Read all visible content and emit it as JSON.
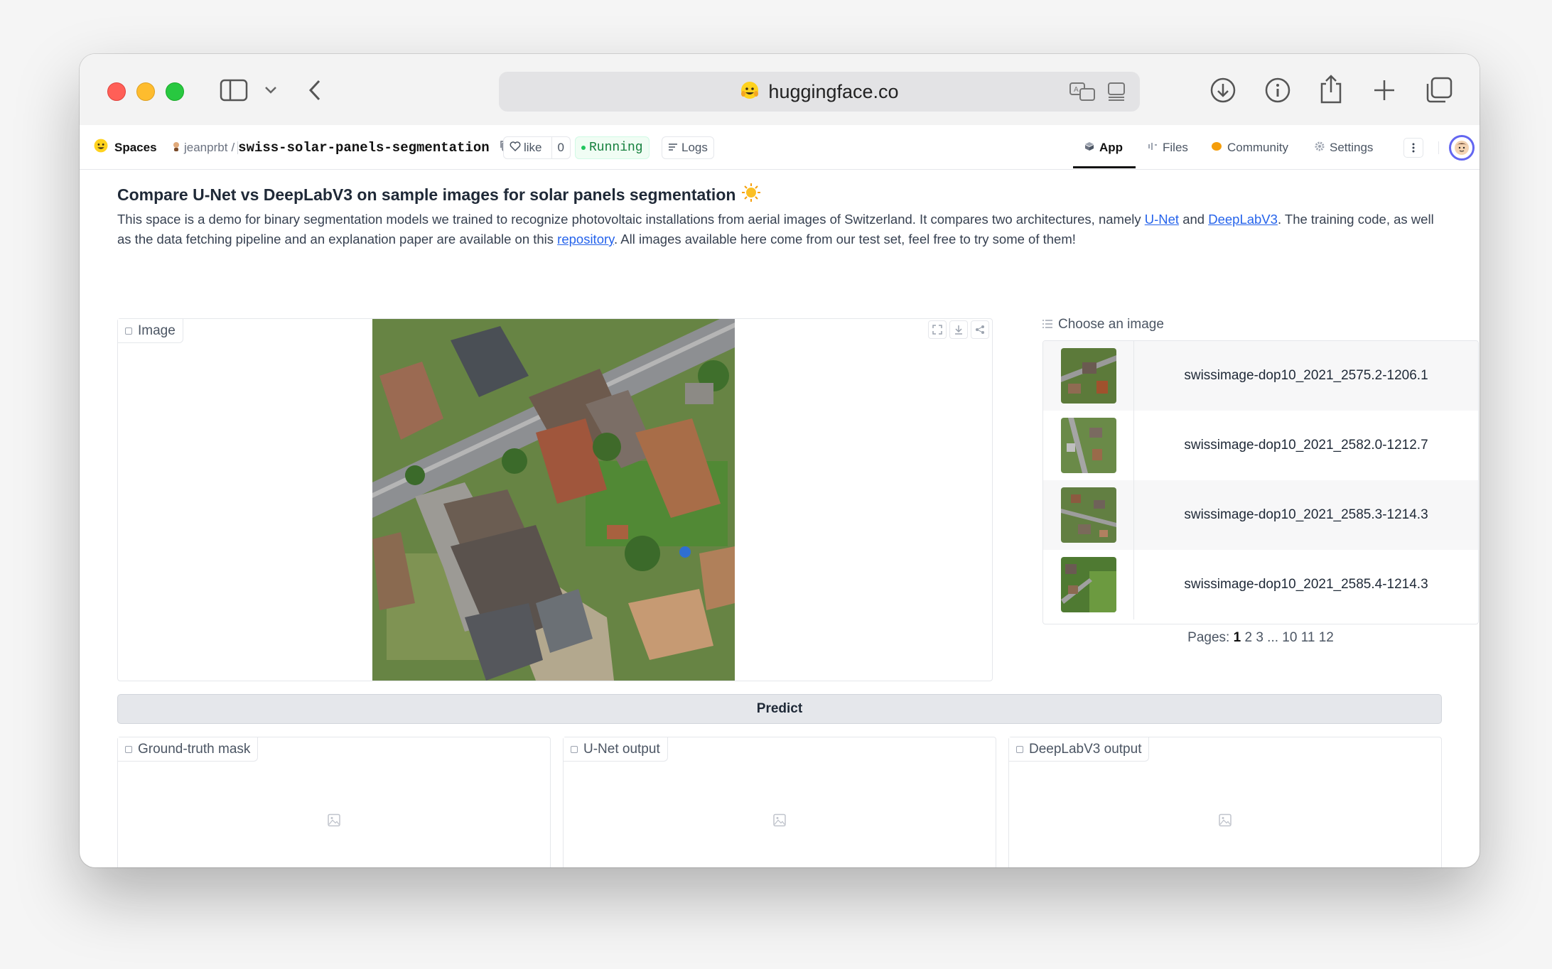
{
  "browser": {
    "url": "huggingface.co"
  },
  "header": {
    "spaces_label": "Spaces",
    "owner": "jeanprbt",
    "separator": "/",
    "repo": "swiss-solar-panels-segmentation",
    "like_label": "like",
    "like_count": "0",
    "status": "Running",
    "logs_label": "Logs",
    "tabs": [
      {
        "label": "App",
        "active": true
      },
      {
        "label": "Files",
        "active": false
      },
      {
        "label": "Community",
        "active": false
      },
      {
        "label": "Settings",
        "active": false
      }
    ]
  },
  "main": {
    "title": "Compare U-Net vs DeepLabV3 on sample images for solar panels segmentation",
    "title_emoji": "☀️",
    "desc": {
      "part1": "This space is a demo for binary segmentation models we trained to recognize photovoltaic installations from aerial images of Switzerland. It compares two architectures, namely ",
      "link1": "U-Net",
      "part2": " and ",
      "link2": "DeepLabV3",
      "part3": ". The training code, as well as the data fetching pipeline and an explanation paper are available on this ",
      "link3": "repository",
      "part4": ". All images available here come from our test set, feel free to try some of them!"
    },
    "image_label": "Image",
    "choose_label": "Choose an image",
    "examples": [
      "swissimage-dop10_2021_2575.2-1206.1",
      "swissimage-dop10_2021_2582.0-1212.7",
      "swissimage-dop10_2021_2585.3-1214.3",
      "swissimage-dop10_2021_2585.4-1214.3"
    ],
    "pages": {
      "label": "Pages:",
      "current": "1",
      "others": "2 3 ... 10 11 12"
    },
    "predict_label": "Predict",
    "outputs": [
      "Ground-truth mask",
      "U-Net output",
      "DeepLabV3 output"
    ]
  },
  "colors": {
    "accent_blue": "#2563eb",
    "running_green": "#15803d"
  }
}
